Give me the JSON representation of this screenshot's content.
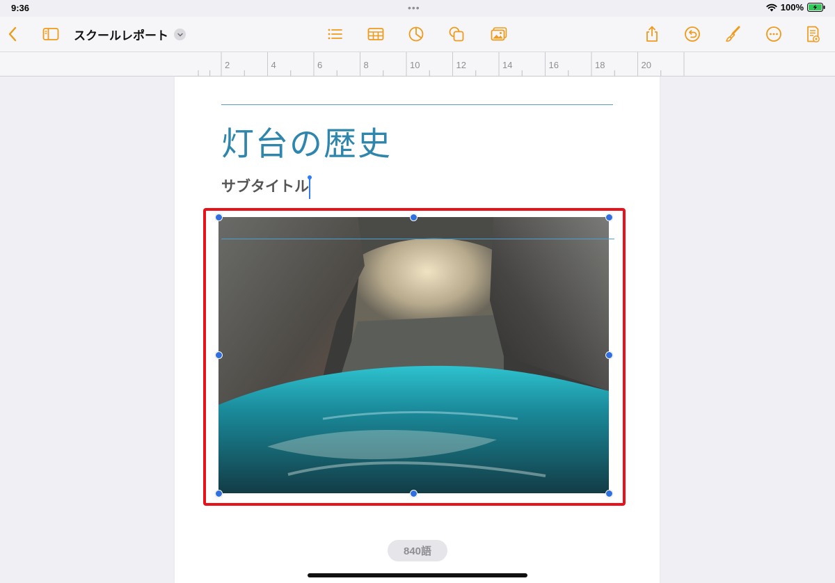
{
  "status_bar": {
    "time": "9:36",
    "battery_percent": "100%",
    "multitask_dots": "•••"
  },
  "toolbar": {
    "document_title": "スクールレポート",
    "accent_color": "#f09a1a",
    "left_icons": [
      "chevron-left-icon",
      "sidebar-icon"
    ],
    "center_icons": [
      "list-icon",
      "table-icon",
      "chart-icon",
      "shapes-icon",
      "media-icon"
    ],
    "right_icons": [
      "share-icon",
      "undo-icon",
      "paintbrush-icon",
      "more-icon",
      "document-view-icon"
    ]
  },
  "ruler": {
    "labels": [
      "2",
      "4",
      "6",
      "8",
      "10",
      "12",
      "14",
      "16",
      "18",
      "20"
    ]
  },
  "document": {
    "title": "灯台の歴史",
    "subtitle": "サブタイトル",
    "title_color": "#2e86ad",
    "image_description_icon": "cave-photo-icon",
    "selection_color": "#2f6fe0",
    "highlight_color": "#e8121b"
  },
  "footer": {
    "word_count": "840語"
  }
}
